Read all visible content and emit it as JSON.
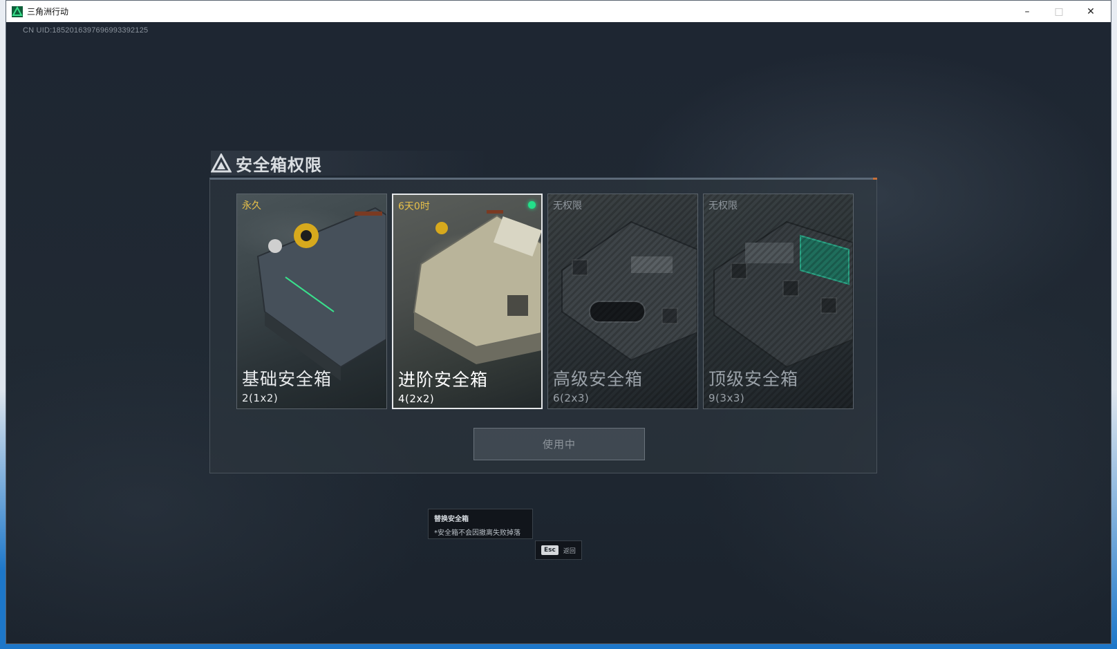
{
  "window": {
    "title": "三角洲行动",
    "controls": {
      "minimize": "–",
      "maximize": "□",
      "close": "✕"
    }
  },
  "uid_text": "CN UID:1852016397696993392125",
  "panel": {
    "title": "安全箱权限",
    "icon": "delta-triangle-icon"
  },
  "cards": [
    {
      "tag": "永久",
      "name": "基础安全箱",
      "size": "2(1x2)",
      "locked": false,
      "active": false
    },
    {
      "tag": "6天0时",
      "name": "进阶安全箱",
      "size": "4(2x2)",
      "locked": false,
      "active": true
    },
    {
      "tag": "无权限",
      "name": "高级安全箱",
      "size": "6(2x3)",
      "locked": true,
      "active": false
    },
    {
      "tag": "无权限",
      "name": "顶级安全箱",
      "size": "9(3x3)",
      "locked": true,
      "active": false
    }
  ],
  "use_button": {
    "label": "使用中"
  },
  "tooltip": {
    "title": "替换安全箱",
    "note": "*安全箱不会因撤离失败掉落"
  },
  "esc_hint": {
    "key": "Esc",
    "label": "返回"
  },
  "colors": {
    "tag_available": "#e8c14a",
    "tag_locked": "#8e959c",
    "text_available": "#e8eaec",
    "text_locked": "#9aa1a8",
    "active_dot": "#23e08a"
  }
}
